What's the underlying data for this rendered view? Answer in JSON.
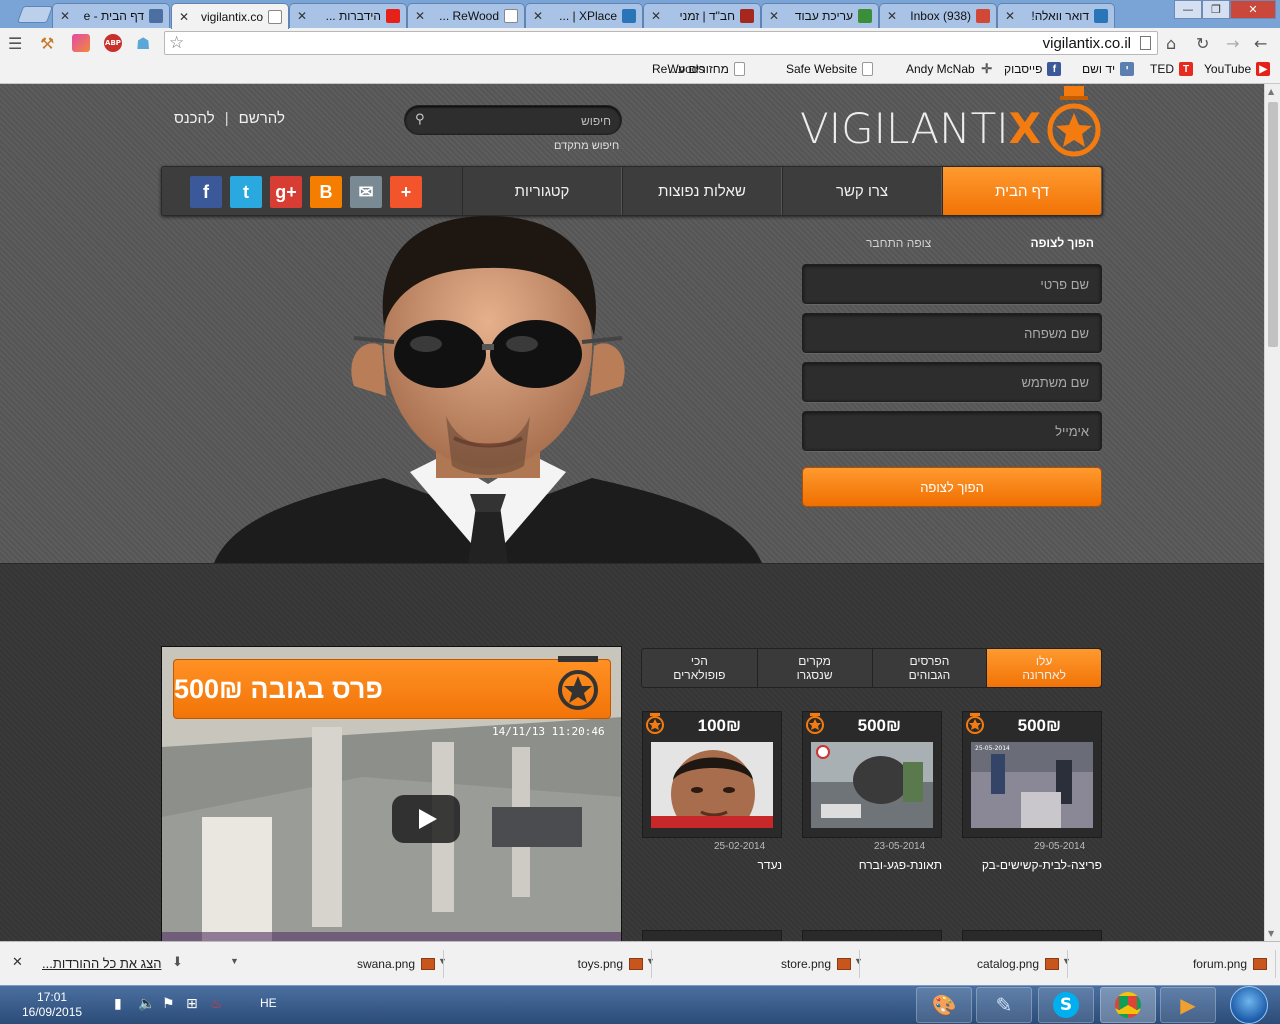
{
  "browser": {
    "tabs": [
      {
        "title": "דף הבית - e",
        "fav": "owl",
        "color": "#4a6fa0",
        "active": false
      },
      {
        "title": "vigilantix.co",
        "fav": "page",
        "color": "#ffffff",
        "active": true
      },
      {
        "title": "הידברות ...",
        "fav": "youtube",
        "color": "#e62117",
        "active": false
      },
      {
        "title": "ReWood ...",
        "fav": "page",
        "color": "#ffffff",
        "active": false
      },
      {
        "title": "XPlace | ...",
        "fav": "xplace",
        "color": "#2a74b8",
        "active": false
      },
      {
        "title": "חב\"ד | זמני",
        "fav": "chabad",
        "color": "#a6281c",
        "active": false
      },
      {
        "title": "עריכת עבוד",
        "fav": "grid",
        "color": "#3b8f3b",
        "active": false
      },
      {
        "title": "Inbox (938)",
        "fav": "gmail",
        "color": "#d14836",
        "active": false
      },
      {
        "title": "דואר וואלה!",
        "fav": "walla",
        "color": "#2a74b8",
        "active": false
      }
    ],
    "url": "vigilantix.co.il",
    "bookmarks": [
      {
        "label": "YouTube",
        "icon": "youtube-icon",
        "color": "#e62117",
        "glyph": "▶"
      },
      {
        "label": "TED",
        "icon": "ted-icon",
        "color": "#e62b1e",
        "glyph": "T"
      },
      {
        "label": "יד ושם",
        "icon": "yadvashem-icon",
        "color": "#5a7fb0",
        "glyph": "י"
      },
      {
        "label": "פייסבוק",
        "icon": "facebook-icon",
        "color": "#3b5998",
        "glyph": "f"
      },
      {
        "label": "Andy McNab",
        "icon": "crosshair-icon",
        "color": "#666666",
        "glyph": "✛"
      },
      {
        "label": "Safe Website",
        "icon": "page-icon",
        "color": "#ffffff",
        "glyph": ""
      },
      {
        "label": "מחזורים ע...",
        "icon": "page-icon",
        "color": "#ffffff",
        "glyph": ""
      },
      {
        "label": "ReWoods",
        "icon": "",
        "color": "",
        "glyph": ""
      }
    ]
  },
  "site": {
    "logo_main": "VIGILANTI",
    "logo_x": "X",
    "accent": "#f47b0f",
    "register": "להרשם",
    "separator": "|",
    "login": "להכנס",
    "search_placeholder": "חיפוש",
    "advanced_search": "חיפוש מתקדם",
    "nav": [
      "דף הבית",
      "צרו קשר",
      "שאלות נפוצות",
      "קטגוריות"
    ],
    "social": [
      {
        "name": "facebook",
        "glyph": "f",
        "color": "#3b5998"
      },
      {
        "name": "twitter",
        "glyph": "t",
        "color": "#2aa9e0"
      },
      {
        "name": "google-plus",
        "glyph": "g+",
        "color": "#d73d32"
      },
      {
        "name": "blogger",
        "glyph": "B",
        "color": "#f57d00"
      },
      {
        "name": "email",
        "glyph": "✉",
        "color": "#7a8a95"
      },
      {
        "name": "share-plus",
        "glyph": "+",
        "color": "#f2552c"
      }
    ],
    "form": {
      "tab_active": "הפוך לצופה",
      "tab_other": "צופה התחבר",
      "fields": [
        "שם פרטי",
        "שם משפחה",
        "שם משתמש",
        "אימייל"
      ],
      "submit": "הפוך לצופה"
    },
    "video": {
      "prize_text": "פרס בגובה 500₪",
      "timestamp": "14/11/13 11:20:46"
    },
    "case_tabs": [
      "עלו\nלאחרונה",
      "הפרסים\nהגבוהים",
      "מקרים\nשנסגרו",
      "הכי\nפופולארים"
    ],
    "cases": [
      {
        "amount": "500₪",
        "date": "29-05-2014",
        "title": "פריצה-לבית-קשישים-בק"
      },
      {
        "amount": "500₪",
        "date": "23-05-2014",
        "title": "תאונת-פגע-וברח"
      },
      {
        "amount": "100₪",
        "date": "25-02-2014",
        "title": "נעדר"
      }
    ],
    "thumb_caption": "25-05-2014"
  },
  "downloads": {
    "files": [
      "forum.png",
      "catalog.png",
      "store.png",
      "toys.png",
      "swana.png"
    ],
    "show_all": "הצג את כל ההורדות..."
  },
  "taskbar": {
    "time": "17:01",
    "date": "16/09/2015",
    "lang": "HE"
  }
}
